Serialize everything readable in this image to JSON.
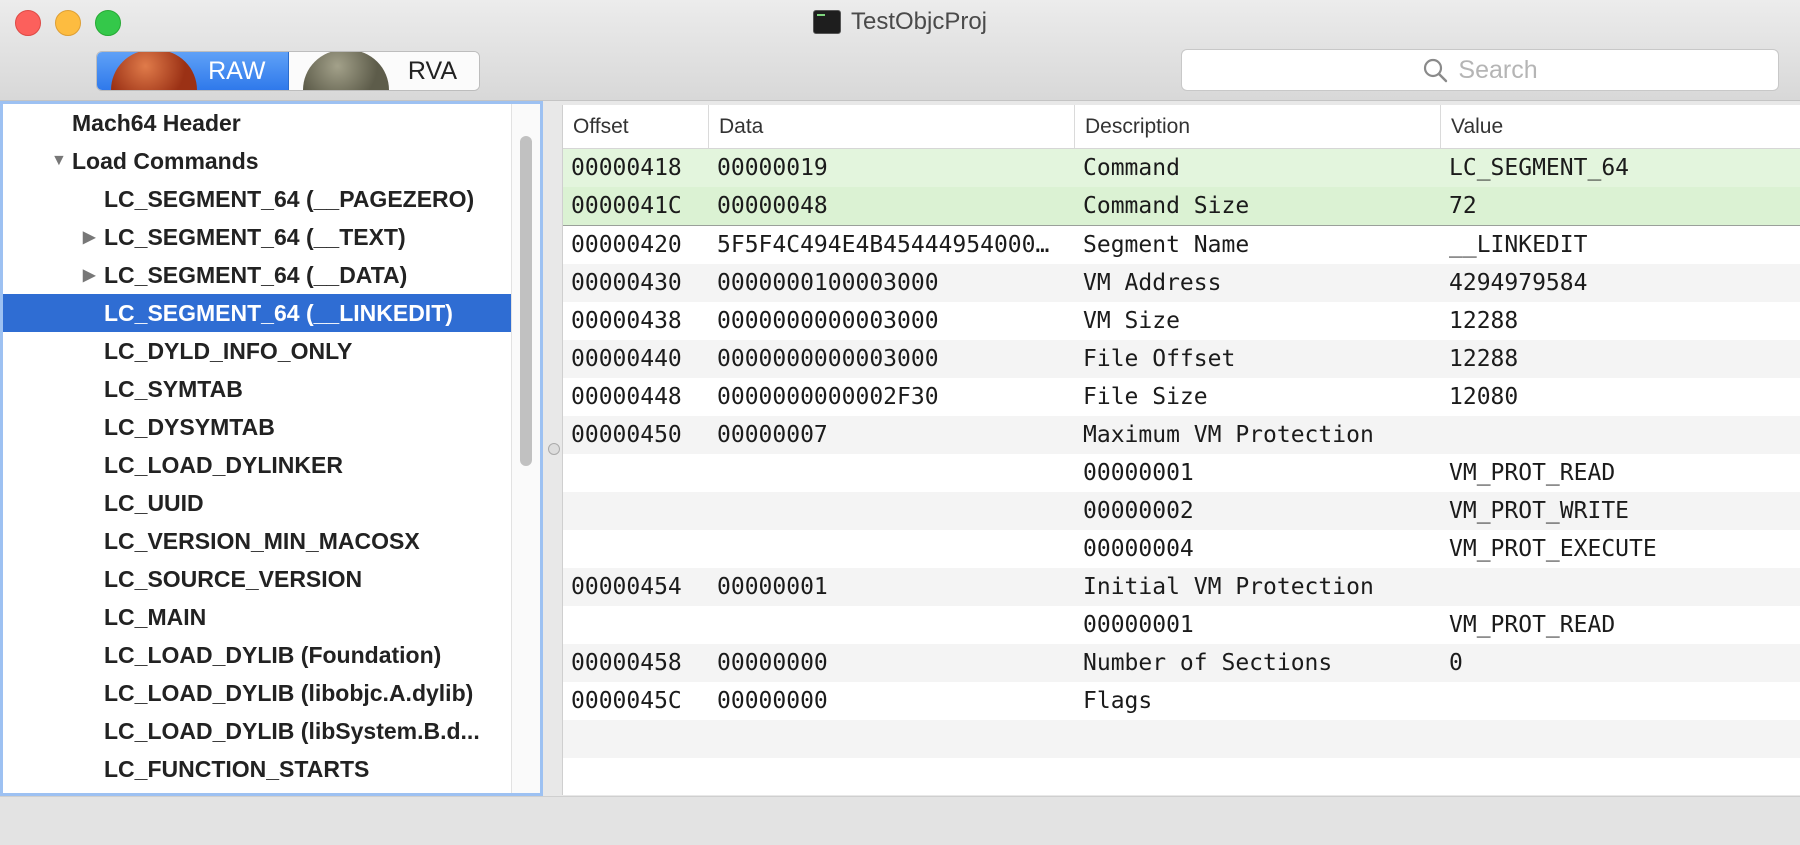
{
  "window": {
    "title": "TestObjcProj"
  },
  "toolbar": {
    "mode_raw": "RAW",
    "mode_rva": "RVA",
    "search_placeholder": "Search"
  },
  "tree": {
    "items": [
      {
        "label": "Mach64 Header",
        "level": 0,
        "disclosure": ""
      },
      {
        "label": "Load Commands",
        "level": 0,
        "disclosure": "▼"
      },
      {
        "label": "LC_SEGMENT_64 (__PAGEZERO)",
        "level": 1,
        "disclosure": ""
      },
      {
        "label": "LC_SEGMENT_64 (__TEXT)",
        "level": 1,
        "disclosure": "▶"
      },
      {
        "label": "LC_SEGMENT_64 (__DATA)",
        "level": 1,
        "disclosure": "▶"
      },
      {
        "label": "LC_SEGMENT_64 (__LINKEDIT)",
        "level": 1,
        "disclosure": "",
        "selected": true
      },
      {
        "label": "LC_DYLD_INFO_ONLY",
        "level": 1,
        "disclosure": ""
      },
      {
        "label": "LC_SYMTAB",
        "level": 1,
        "disclosure": ""
      },
      {
        "label": "LC_DYSYMTAB",
        "level": 1,
        "disclosure": ""
      },
      {
        "label": "LC_LOAD_DYLINKER",
        "level": 1,
        "disclosure": ""
      },
      {
        "label": "LC_UUID",
        "level": 1,
        "disclosure": ""
      },
      {
        "label": "LC_VERSION_MIN_MACOSX",
        "level": 1,
        "disclosure": ""
      },
      {
        "label": "LC_SOURCE_VERSION",
        "level": 1,
        "disclosure": ""
      },
      {
        "label": "LC_MAIN",
        "level": 1,
        "disclosure": ""
      },
      {
        "label": "LC_LOAD_DYLIB (Foundation)",
        "level": 1,
        "disclosure": ""
      },
      {
        "label": "LC_LOAD_DYLIB (libobjc.A.dylib)",
        "level": 1,
        "disclosure": ""
      },
      {
        "label": "LC_LOAD_DYLIB (libSystem.B.d...",
        "level": 1,
        "disclosure": ""
      },
      {
        "label": "LC_FUNCTION_STARTS",
        "level": 1,
        "disclosure": ""
      }
    ]
  },
  "table": {
    "columns": [
      "Offset",
      "Data",
      "Description",
      "Value"
    ],
    "rows": [
      {
        "offset": "00000418",
        "data": "00000019",
        "description": "Command",
        "value": "LC_SEGMENT_64",
        "highlight": true
      },
      {
        "offset": "0000041C",
        "data": "00000048",
        "description": "Command Size",
        "value": "72",
        "highlight": true
      },
      {
        "offset": "00000420",
        "data": "5F5F4C494E4B45444954000…",
        "description": "Segment Name",
        "value": "__LINKEDIT"
      },
      {
        "offset": "00000430",
        "data": "0000000100003000",
        "description": "VM Address",
        "value": "4294979584"
      },
      {
        "offset": "00000438",
        "data": "0000000000003000",
        "description": "VM Size",
        "value": "12288"
      },
      {
        "offset": "00000440",
        "data": "0000000000003000",
        "description": "File Offset",
        "value": "12288"
      },
      {
        "offset": "00000448",
        "data": "0000000000002F30",
        "description": "File Size",
        "value": "12080"
      },
      {
        "offset": "00000450",
        "data": "00000007",
        "description": "Maximum VM Protection",
        "value": ""
      },
      {
        "offset": "",
        "data": "",
        "description": "00000001",
        "value": "VM_PROT_READ"
      },
      {
        "offset": "",
        "data": "",
        "description": "00000002",
        "value": "VM_PROT_WRITE"
      },
      {
        "offset": "",
        "data": "",
        "description": "00000004",
        "value": "VM_PROT_EXECUTE"
      },
      {
        "offset": "00000454",
        "data": "00000001",
        "description": "Initial VM Protection",
        "value": ""
      },
      {
        "offset": "",
        "data": "",
        "description": "00000001",
        "value": "VM_PROT_READ"
      },
      {
        "offset": "00000458",
        "data": "00000000",
        "description": "Number of Sections",
        "value": "0"
      },
      {
        "offset": "0000045C",
        "data": "00000000",
        "description": "Flags",
        "value": ""
      },
      {
        "offset": "",
        "data": "",
        "description": "",
        "value": ""
      }
    ]
  },
  "colors": {
    "selection": "#2f6dd3",
    "highlight_row": "#e3f5dd",
    "focus_ring": "#9dc1f2"
  }
}
